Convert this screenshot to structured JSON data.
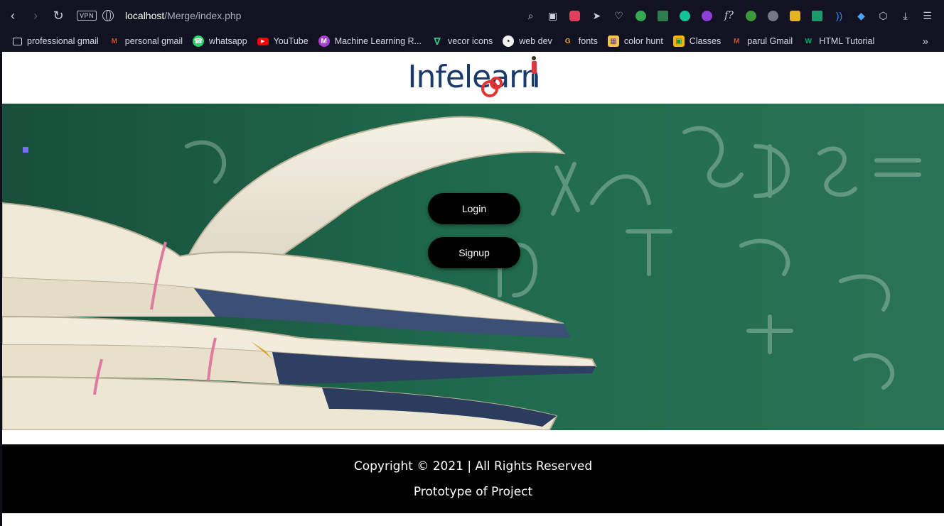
{
  "browser": {
    "url_host": "localhost",
    "url_path": "/Merge/index.php",
    "vpn_label": "VPN"
  },
  "bookmarks": [
    {
      "label": "professional gmail",
      "icon": "folder-icon",
      "color": "#d9d9e4"
    },
    {
      "label": "personal gmail",
      "icon": "gmail-icon",
      "color": "#ea4335"
    },
    {
      "label": "whatsapp",
      "icon": "whatsapp-icon",
      "color": "#25d366"
    },
    {
      "label": "YouTube",
      "icon": "youtube-icon",
      "color": "#ff0000"
    },
    {
      "label": "Machine Learning R...",
      "icon": "m-icon",
      "color": "#a63fd1"
    },
    {
      "label": "vecor icons",
      "icon": "vector-icon",
      "color": "#3fbf8a"
    },
    {
      "label": "web dev",
      "icon": "webdev-icon",
      "color": "#f1f1f1"
    },
    {
      "label": "fonts",
      "icon": "fonts-icon",
      "color": "#e8a321"
    },
    {
      "label": "color hunt",
      "icon": "colorhunt-icon",
      "color": "#f4c542"
    },
    {
      "label": "Classes",
      "icon": "classroom-icon",
      "color": "#f4b400"
    },
    {
      "label": "parul Gmail",
      "icon": "gmail-icon",
      "color": "#ea4335"
    },
    {
      "label": "HTML Tutorial",
      "icon": "w3-icon",
      "color": "#04aa6d"
    }
  ],
  "page": {
    "logo_text": "Infelearn",
    "buttons": {
      "login": "Login",
      "signup": "Signup"
    },
    "footer": {
      "copyright": "Copyright © 2021 | All Rights Reserved",
      "subtitle": "Prototype of Project"
    }
  }
}
